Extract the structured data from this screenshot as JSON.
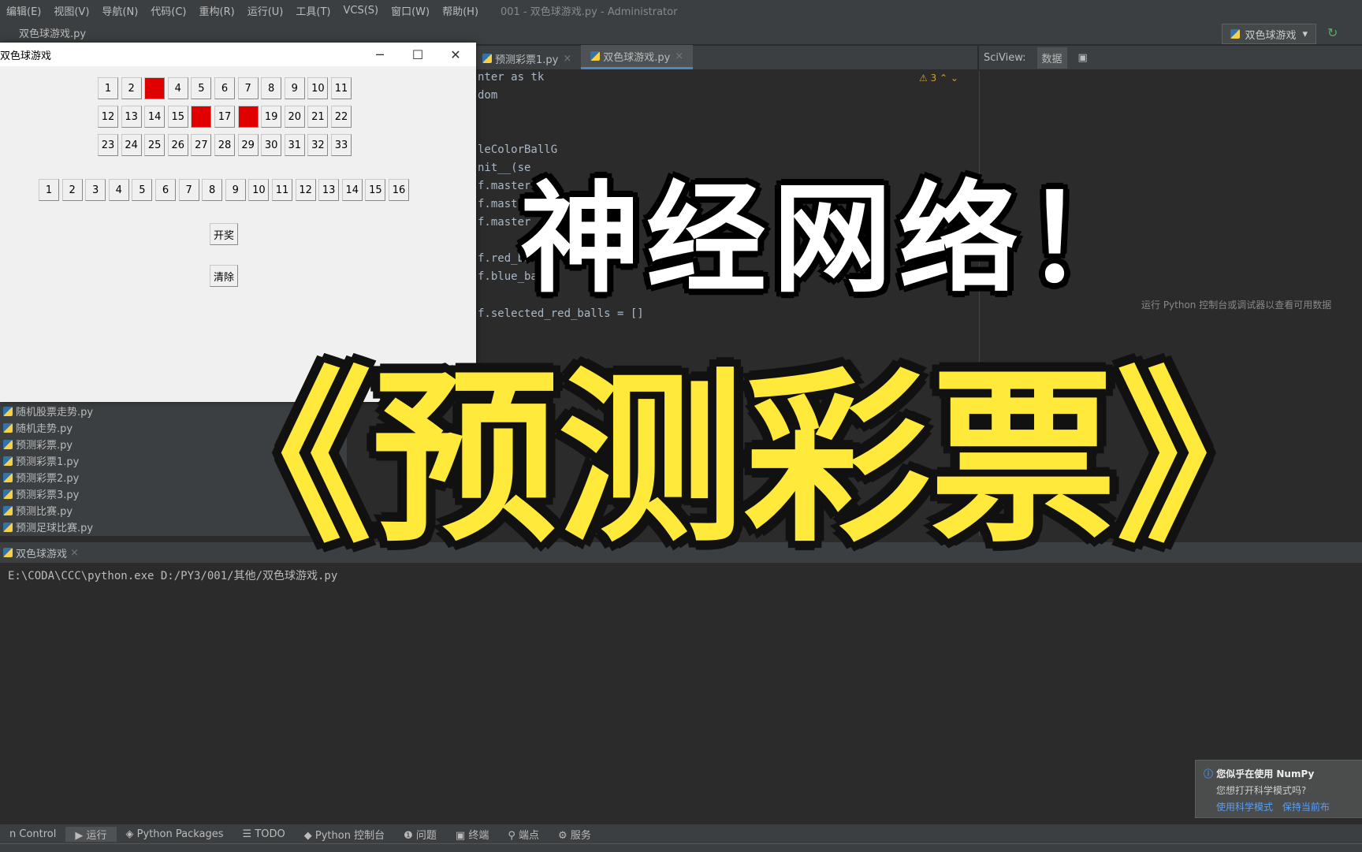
{
  "ide": {
    "menu": [
      "编辑(E)",
      "视图(V)",
      "导航(N)",
      "代码(C)",
      "重构(R)",
      "运行(U)",
      "工具(T)",
      "VCS(S)",
      "窗口(W)",
      "帮助(H)"
    ],
    "window_title": "001 - 双色球游戏.py - Administrator",
    "breadcrumb": "双色球游戏.py",
    "run_config": "双色球游戏",
    "editor_tabs": [
      {
        "label": "预测彩票1.py",
        "active": false
      },
      {
        "label": "双色球游戏.py",
        "active": true
      }
    ],
    "warning_count": "3",
    "code_lines": [
      {
        "text": "nter as tk"
      },
      {
        "text": "dom"
      },
      {
        "text": "leColorBallG"
      },
      {
        "text": "nit__(se"
      },
      {
        "text": "f.master"
      },
      {
        "text": "f.master"
      },
      {
        "text": "f.master"
      },
      {
        "text": "f.red_ba"
      },
      {
        "text": "f.blue_bal"
      },
      {
        "text": "f.selected_red_balls = []"
      }
    ],
    "sciview": {
      "title": "SciView:",
      "tab_data": "数据",
      "hint": "运行 Python 控制台或调试器以查看可用数据"
    },
    "project_files": [
      "随机股票走势.py",
      "随机走势.py",
      "预测彩票.py",
      "预测彩票1.py",
      "预测彩票2.py",
      "预测彩票3.py",
      "预测比赛.py",
      "预测足球比赛.py"
    ],
    "run_tab": "双色球游戏",
    "run_command": "E:\\CODA\\CCC\\python.exe D:/PY3/001/其他/双色球游戏.py",
    "tool_windows": [
      "n Control",
      "运行",
      "Python Packages",
      "TODO",
      "Python 控制台",
      "问题",
      "终端",
      "端点",
      "服务"
    ],
    "notification": {
      "title": "您似乎在使用 NumPy",
      "body": "您想打开科学模式吗?",
      "link1": "使用科学模式",
      "link2": "保持当前布"
    }
  },
  "tk": {
    "title": "双色球游戏",
    "red_balls": [
      "1",
      "2",
      "3",
      "4",
      "5",
      "6",
      "7",
      "8",
      "9",
      "10",
      "11",
      "12",
      "13",
      "14",
      "15",
      "16",
      "17",
      "18",
      "19",
      "20",
      "21",
      "22",
      "23",
      "24",
      "25",
      "26",
      "27",
      "28",
      "29",
      "30",
      "31",
      "32",
      "33"
    ],
    "selected_red": [
      "3",
      "16",
      "18"
    ],
    "blue_balls": [
      "1",
      "2",
      "3",
      "4",
      "5",
      "6",
      "7",
      "8",
      "9",
      "10",
      "11",
      "12",
      "13",
      "14",
      "15",
      "16"
    ],
    "draw_button": "开奖",
    "clear_button": "清除"
  },
  "overlay": {
    "line1": "神经网络！",
    "line2": "《预测彩票》"
  },
  "colors": {
    "selected_ball": "#e00000",
    "overlay_yellow": "#ffe93a",
    "ide_bg": "#2b2b2b"
  }
}
